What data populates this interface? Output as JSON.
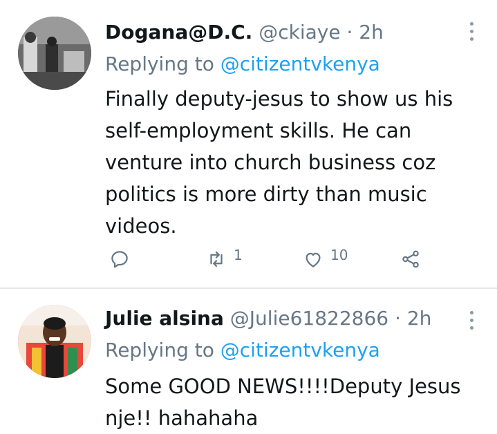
{
  "tweets": [
    {
      "name": "Dogana@D.C.",
      "handle": "@ckiaye",
      "dot": "·",
      "time": "2h",
      "replying_prefix": "Replying to",
      "replying_to": "@citizentvkenya",
      "text": "Finally deputy-jesus to show us his self-employment skills. He can venture into church business coz politics is more dirty than music videos.",
      "retweets": "1",
      "likes": "10"
    },
    {
      "name": "Julie alsina",
      "handle": "@Julie61822866",
      "dot": "·",
      "time": "2h",
      "replying_prefix": "Replying to",
      "replying_to": "@citizentvkenya",
      "text": "Some GOOD NEWS!!!!Deputy Jesus nje!! hahahaha"
    }
  ],
  "icons": {
    "reply": "reply-icon",
    "retweet": "retweet-icon",
    "like": "heart-icon",
    "share": "share-icon",
    "more": "more-vertical-icon"
  },
  "colors": {
    "mention": "#1da1f2",
    "muted": "#657786",
    "text": "#14171a"
  }
}
